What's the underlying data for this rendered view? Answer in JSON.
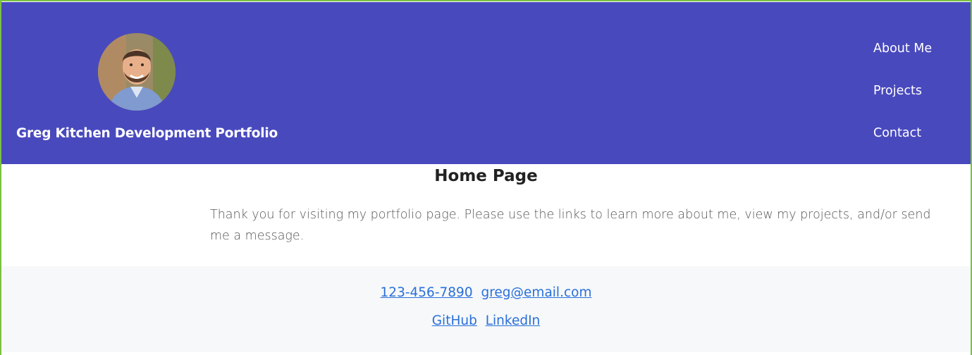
{
  "header": {
    "site_title": "Greg Kitchen Development Portfolio",
    "nav": [
      {
        "label": "About Me"
      },
      {
        "label": "Projects"
      },
      {
        "label": "Contact"
      }
    ]
  },
  "main": {
    "title": "Home Page",
    "intro": "Thank you for visiting my portfolio page. Please use the links to learn more about me, view my projects, and/or send me a message."
  },
  "footer": {
    "phone": "123-456-7890",
    "email": "greg@email.com",
    "github": "GitHub",
    "linkedin": "LinkedIn"
  },
  "colors": {
    "header_bg": "#4949be",
    "link": "#2a6fdb",
    "footer_bg": "#f6f8f9",
    "frame_border": "#7bc043"
  }
}
